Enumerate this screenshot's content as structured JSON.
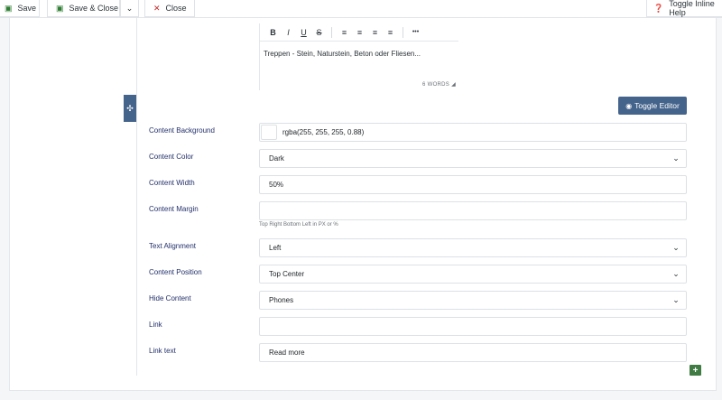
{
  "toolbar": {
    "save": "Save",
    "save_close": "Save & Close",
    "close": "Close",
    "help": "Toggle Inline Help"
  },
  "editor": {
    "tools": [
      "B",
      "I",
      "U",
      "S"
    ],
    "align_tools": [
      "≡",
      "≡",
      "≡",
      "≡"
    ],
    "more": "•••",
    "content": "Treppen - Stein, Naturstein, Beton oder Fliesen...",
    "word_count": "6 WORDS"
  },
  "toggle_editor": "Toggle Editor",
  "form": {
    "content_background": {
      "label": "Content Background",
      "value": "rgba(255, 255, 255, 0.88)"
    },
    "content_color": {
      "label": "Content Color",
      "value": "Dark"
    },
    "content_width": {
      "label": "Content Width",
      "value": "50%"
    },
    "content_margin": {
      "label": "Content Margin",
      "value": "",
      "hint": "Top Right Bottom Left in PX or %"
    },
    "text_alignment": {
      "label": "Text Alignment",
      "value": "Left"
    },
    "content_position": {
      "label": "Content Position",
      "value": "Top Center"
    },
    "hide_content": {
      "label": "Hide Content",
      "value": "Phones"
    },
    "link": {
      "label": "Link",
      "value": ""
    },
    "link_text": {
      "label": "Link text",
      "value": "Read more"
    }
  },
  "colors": {
    "accent": "#45648c",
    "add": "#3f7b43",
    "label": "#23306b"
  }
}
